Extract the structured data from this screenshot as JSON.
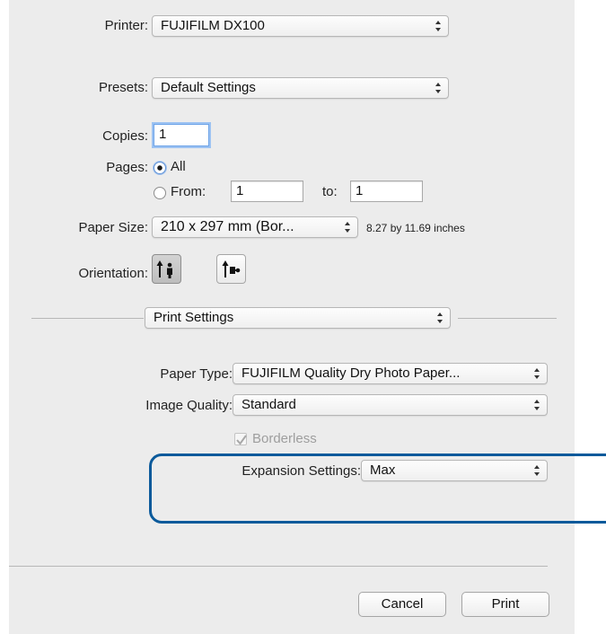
{
  "printer": {
    "label": "Printer:",
    "value": "FUJIFILM DX100"
  },
  "presets": {
    "label": "Presets:",
    "value": "Default Settings"
  },
  "copies": {
    "label": "Copies:",
    "value": "1"
  },
  "pages": {
    "label": "Pages:",
    "all_label": "All",
    "from_label": "From:",
    "from_value": "1",
    "to_label": "to:",
    "to_value": "1"
  },
  "paper_size": {
    "label": "Paper Size:",
    "value": "210 x 297 mm (Bor...",
    "dimensions": "8.27 by 11.69 inches"
  },
  "orientation": {
    "label": "Orientation:"
  },
  "section": {
    "value": "Print Settings"
  },
  "paper_type": {
    "label": "Paper Type:",
    "value": "FUJIFILM Quality Dry Photo Paper..."
  },
  "image_quality": {
    "label": "Image Quality:",
    "value": "Standard"
  },
  "borderless": {
    "label": "Borderless"
  },
  "expansion": {
    "label": "Expansion Settings:",
    "value": "Max"
  },
  "buttons": {
    "cancel": "Cancel",
    "print": "Print"
  },
  "colors": {
    "highlight": "#0b5a9b",
    "focus": "#6ea4e8"
  }
}
